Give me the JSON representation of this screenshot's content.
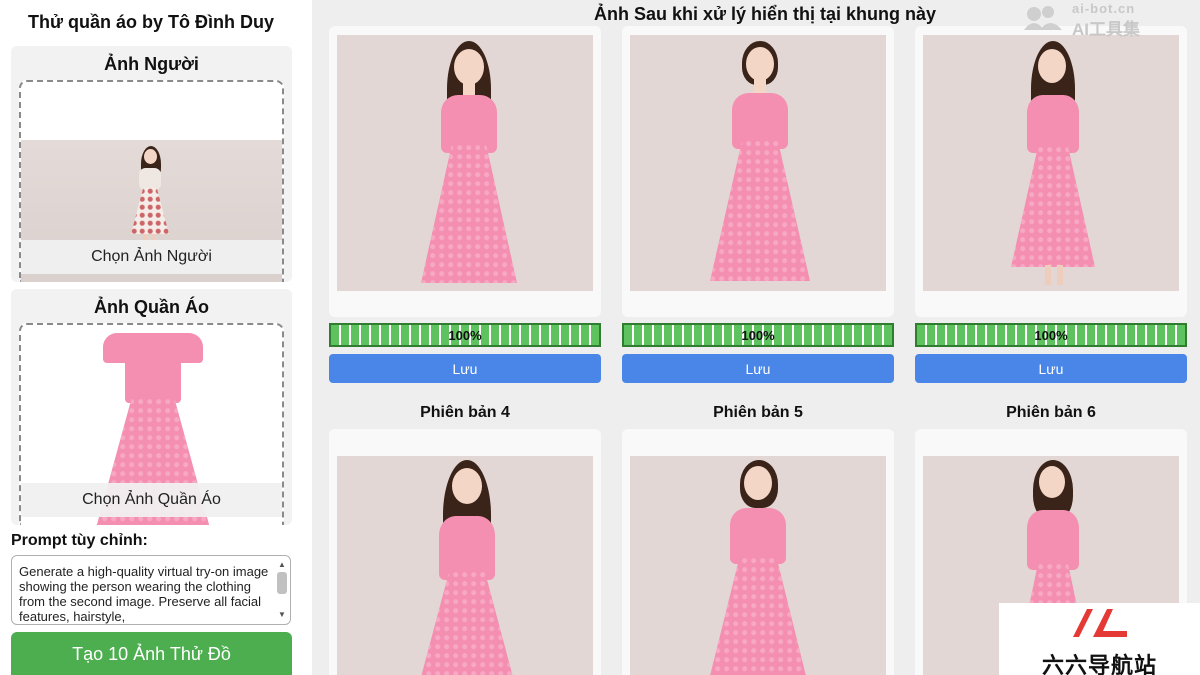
{
  "app": {
    "title": "Thử quần áo by Tô Đình Duy"
  },
  "person_upload": {
    "title": "Ảnh Người",
    "button_label": "Chọn Ảnh Người"
  },
  "cloth_upload": {
    "title": "Ảnh Quần Áo",
    "button_label": "Chọn Ảnh Quần Áo"
  },
  "prompt": {
    "label": "Prompt tùy chỉnh:",
    "value": "Generate a high-quality virtual try-on image showing the person wearing the clothing from the second image. Preserve all facial features, hairstyle,"
  },
  "generate_button": {
    "label": "Tạo 10 Ảnh Thử Đồ"
  },
  "main": {
    "header": "Ảnh Sau khi xử lý hiển thị tại khung này"
  },
  "watermark": {
    "url": "ai-bot.cn",
    "name": "AI工具集"
  },
  "results": [
    {
      "progress_text": "100%",
      "progress_value": 1.0,
      "save_label": "Lưu"
    },
    {
      "progress_text": "100%",
      "progress_value": 1.0,
      "save_label": "Lưu"
    },
    {
      "progress_text": "100%",
      "progress_value": 1.0,
      "save_label": "Lưu"
    }
  ],
  "variants": [
    {
      "title": "Phiên bản 4"
    },
    {
      "title": "Phiên bản 5"
    },
    {
      "title": "Phiên bản 6"
    }
  ],
  "brand": {
    "text": "六六导航站",
    "mark": "logo-mark"
  },
  "colors": {
    "generate": "#4cae4f",
    "save": "#4a86e8",
    "progress": "#5ec35e",
    "dress": "#f48fb1"
  }
}
